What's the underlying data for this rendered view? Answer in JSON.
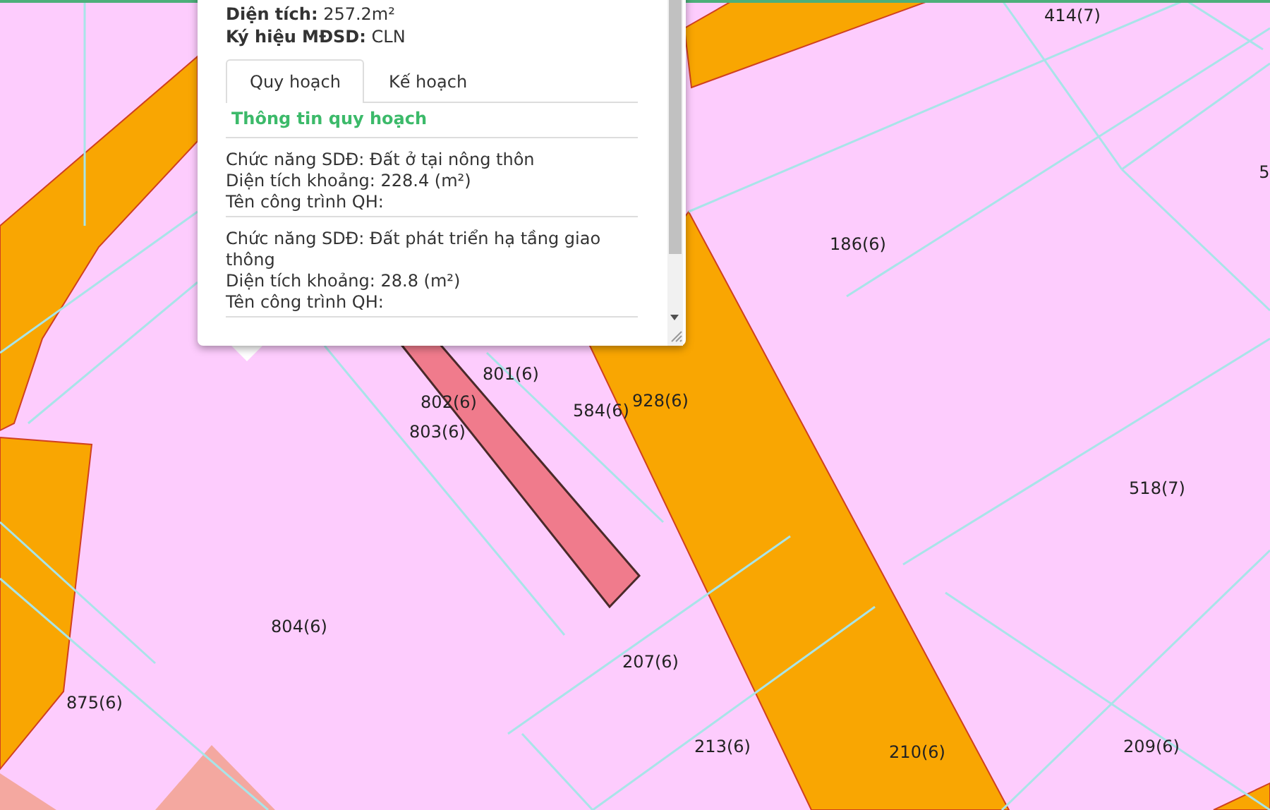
{
  "map": {
    "parcel_labels": [
      "414(7)",
      "5",
      "186(6)",
      "801(6)",
      "802(6)",
      "803(6)",
      "584(6)",
      "928(6)",
      "518(7)",
      "804(6)",
      "207(6)",
      "875(6)",
      "213(6)",
      "210(6)",
      "209(6)"
    ]
  },
  "popup": {
    "fields": [
      {
        "label": "Diện tích:",
        "value": "257.2m²"
      },
      {
        "label": "Ký hiệu MĐSD:",
        "value": "CLN"
      }
    ],
    "tabs": [
      {
        "label": "Quy hoạch",
        "selected": true
      },
      {
        "label": "Kế hoạch",
        "selected": false
      }
    ],
    "section_title": "Thông tin quy hoạch",
    "entries": [
      [
        "Chức năng SDĐ: Đất ở tại nông thôn",
        "Diện tích khoảng: 228.4 (m²)",
        "Tên công trình QH:"
      ],
      [
        "Chức năng SDĐ: Đất phát triển hạ tầng giao thông",
        "Diện tích khoảng: 28.8 (m²)",
        "Tên công trình QH:"
      ]
    ]
  }
}
